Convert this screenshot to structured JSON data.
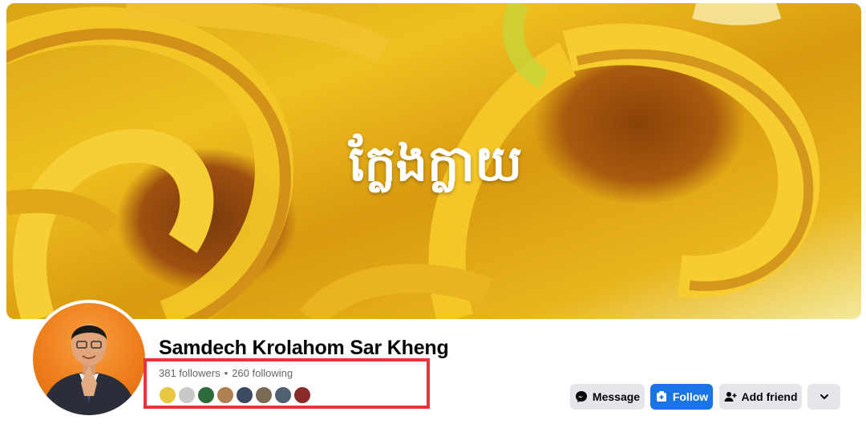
{
  "cover": {
    "overlay_text": "ក្លែងក្លាយ",
    "colors": {
      "gold": "#f0c020",
      "deep": "#9e5010"
    }
  },
  "profile": {
    "name": "Samdech Krolahom Sar Kheng",
    "followers": "381 followers",
    "separator": "•",
    "following": "260 following",
    "follower_faces": [
      "#e8c640",
      "#c9c9c9",
      "#2f6b3a",
      "#b08050",
      "#3a4a60",
      "#7a6a55",
      "#506070",
      "#8a2a2a"
    ]
  },
  "actions": {
    "message_label": "Message",
    "follow_label": "Follow",
    "add_friend_label": "Add friend"
  },
  "theme": {
    "accent": "#1b74e4",
    "highlight": "#e8333a",
    "button_bg": "#e4e6eb"
  }
}
